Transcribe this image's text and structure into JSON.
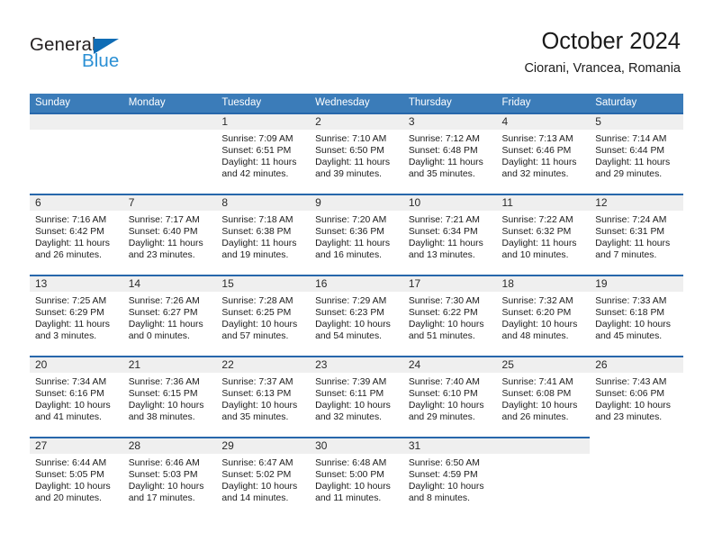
{
  "brand": {
    "name_part1": "General",
    "name_part2": "Blue",
    "triangle_color": "#0f6cb5",
    "blue_color": "#2a8fd4"
  },
  "header": {
    "title": "October 2024",
    "subtitle": "Ciorani, Vrancea, Romania"
  },
  "theme": {
    "header_blue": "#3b7cb9",
    "row_rule_blue": "#2767ab",
    "daynum_band": "#efefef"
  },
  "weekdays": [
    "Sunday",
    "Monday",
    "Tuesday",
    "Wednesday",
    "Thursday",
    "Friday",
    "Saturday"
  ],
  "weeks": [
    [
      {
        "day": "",
        "blank": true
      },
      {
        "day": "",
        "blank": true
      },
      {
        "day": "1",
        "sunrise": "Sunrise: 7:09 AM",
        "sunset": "Sunset: 6:51 PM",
        "daylight1": "Daylight: 11 hours",
        "daylight2": "and 42 minutes."
      },
      {
        "day": "2",
        "sunrise": "Sunrise: 7:10 AM",
        "sunset": "Sunset: 6:50 PM",
        "daylight1": "Daylight: 11 hours",
        "daylight2": "and 39 minutes."
      },
      {
        "day": "3",
        "sunrise": "Sunrise: 7:12 AM",
        "sunset": "Sunset: 6:48 PM",
        "daylight1": "Daylight: 11 hours",
        "daylight2": "and 35 minutes."
      },
      {
        "day": "4",
        "sunrise": "Sunrise: 7:13 AM",
        "sunset": "Sunset: 6:46 PM",
        "daylight1": "Daylight: 11 hours",
        "daylight2": "and 32 minutes."
      },
      {
        "day": "5",
        "sunrise": "Sunrise: 7:14 AM",
        "sunset": "Sunset: 6:44 PM",
        "daylight1": "Daylight: 11 hours",
        "daylight2": "and 29 minutes."
      }
    ],
    [
      {
        "day": "6",
        "sunrise": "Sunrise: 7:16 AM",
        "sunset": "Sunset: 6:42 PM",
        "daylight1": "Daylight: 11 hours",
        "daylight2": "and 26 minutes."
      },
      {
        "day": "7",
        "sunrise": "Sunrise: 7:17 AM",
        "sunset": "Sunset: 6:40 PM",
        "daylight1": "Daylight: 11 hours",
        "daylight2": "and 23 minutes."
      },
      {
        "day": "8",
        "sunrise": "Sunrise: 7:18 AM",
        "sunset": "Sunset: 6:38 PM",
        "daylight1": "Daylight: 11 hours",
        "daylight2": "and 19 minutes."
      },
      {
        "day": "9",
        "sunrise": "Sunrise: 7:20 AM",
        "sunset": "Sunset: 6:36 PM",
        "daylight1": "Daylight: 11 hours",
        "daylight2": "and 16 minutes."
      },
      {
        "day": "10",
        "sunrise": "Sunrise: 7:21 AM",
        "sunset": "Sunset: 6:34 PM",
        "daylight1": "Daylight: 11 hours",
        "daylight2": "and 13 minutes."
      },
      {
        "day": "11",
        "sunrise": "Sunrise: 7:22 AM",
        "sunset": "Sunset: 6:32 PM",
        "daylight1": "Daylight: 11 hours",
        "daylight2": "and 10 minutes."
      },
      {
        "day": "12",
        "sunrise": "Sunrise: 7:24 AM",
        "sunset": "Sunset: 6:31 PM",
        "daylight1": "Daylight: 11 hours",
        "daylight2": "and 7 minutes."
      }
    ],
    [
      {
        "day": "13",
        "sunrise": "Sunrise: 7:25 AM",
        "sunset": "Sunset: 6:29 PM",
        "daylight1": "Daylight: 11 hours",
        "daylight2": "and 3 minutes."
      },
      {
        "day": "14",
        "sunrise": "Sunrise: 7:26 AM",
        "sunset": "Sunset: 6:27 PM",
        "daylight1": "Daylight: 11 hours",
        "daylight2": "and 0 minutes."
      },
      {
        "day": "15",
        "sunrise": "Sunrise: 7:28 AM",
        "sunset": "Sunset: 6:25 PM",
        "daylight1": "Daylight: 10 hours",
        "daylight2": "and 57 minutes."
      },
      {
        "day": "16",
        "sunrise": "Sunrise: 7:29 AM",
        "sunset": "Sunset: 6:23 PM",
        "daylight1": "Daylight: 10 hours",
        "daylight2": "and 54 minutes."
      },
      {
        "day": "17",
        "sunrise": "Sunrise: 7:30 AM",
        "sunset": "Sunset: 6:22 PM",
        "daylight1": "Daylight: 10 hours",
        "daylight2": "and 51 minutes."
      },
      {
        "day": "18",
        "sunrise": "Sunrise: 7:32 AM",
        "sunset": "Sunset: 6:20 PM",
        "daylight1": "Daylight: 10 hours",
        "daylight2": "and 48 minutes."
      },
      {
        "day": "19",
        "sunrise": "Sunrise: 7:33 AM",
        "sunset": "Sunset: 6:18 PM",
        "daylight1": "Daylight: 10 hours",
        "daylight2": "and 45 minutes."
      }
    ],
    [
      {
        "day": "20",
        "sunrise": "Sunrise: 7:34 AM",
        "sunset": "Sunset: 6:16 PM",
        "daylight1": "Daylight: 10 hours",
        "daylight2": "and 41 minutes."
      },
      {
        "day": "21",
        "sunrise": "Sunrise: 7:36 AM",
        "sunset": "Sunset: 6:15 PM",
        "daylight1": "Daylight: 10 hours",
        "daylight2": "and 38 minutes."
      },
      {
        "day": "22",
        "sunrise": "Sunrise: 7:37 AM",
        "sunset": "Sunset: 6:13 PM",
        "daylight1": "Daylight: 10 hours",
        "daylight2": "and 35 minutes."
      },
      {
        "day": "23",
        "sunrise": "Sunrise: 7:39 AM",
        "sunset": "Sunset: 6:11 PM",
        "daylight1": "Daylight: 10 hours",
        "daylight2": "and 32 minutes."
      },
      {
        "day": "24",
        "sunrise": "Sunrise: 7:40 AM",
        "sunset": "Sunset: 6:10 PM",
        "daylight1": "Daylight: 10 hours",
        "daylight2": "and 29 minutes."
      },
      {
        "day": "25",
        "sunrise": "Sunrise: 7:41 AM",
        "sunset": "Sunset: 6:08 PM",
        "daylight1": "Daylight: 10 hours",
        "daylight2": "and 26 minutes."
      },
      {
        "day": "26",
        "sunrise": "Sunrise: 7:43 AM",
        "sunset": "Sunset: 6:06 PM",
        "daylight1": "Daylight: 10 hours",
        "daylight2": "and 23 minutes."
      }
    ],
    [
      {
        "day": "27",
        "sunrise": "Sunrise: 6:44 AM",
        "sunset": "Sunset: 5:05 PM",
        "daylight1": "Daylight: 10 hours",
        "daylight2": "and 20 minutes."
      },
      {
        "day": "28",
        "sunrise": "Sunrise: 6:46 AM",
        "sunset": "Sunset: 5:03 PM",
        "daylight1": "Daylight: 10 hours",
        "daylight2": "and 17 minutes."
      },
      {
        "day": "29",
        "sunrise": "Sunrise: 6:47 AM",
        "sunset": "Sunset: 5:02 PM",
        "daylight1": "Daylight: 10 hours",
        "daylight2": "and 14 minutes."
      },
      {
        "day": "30",
        "sunrise": "Sunrise: 6:48 AM",
        "sunset": "Sunset: 5:00 PM",
        "daylight1": "Daylight: 10 hours",
        "daylight2": "and 11 minutes."
      },
      {
        "day": "31",
        "sunrise": "Sunrise: 6:50 AM",
        "sunset": "Sunset: 4:59 PM",
        "daylight1": "Daylight: 10 hours",
        "daylight2": "and 8 minutes."
      },
      {
        "day": "",
        "blank": true
      },
      {
        "day": "",
        "blank": true,
        "trailing": true
      }
    ]
  ]
}
